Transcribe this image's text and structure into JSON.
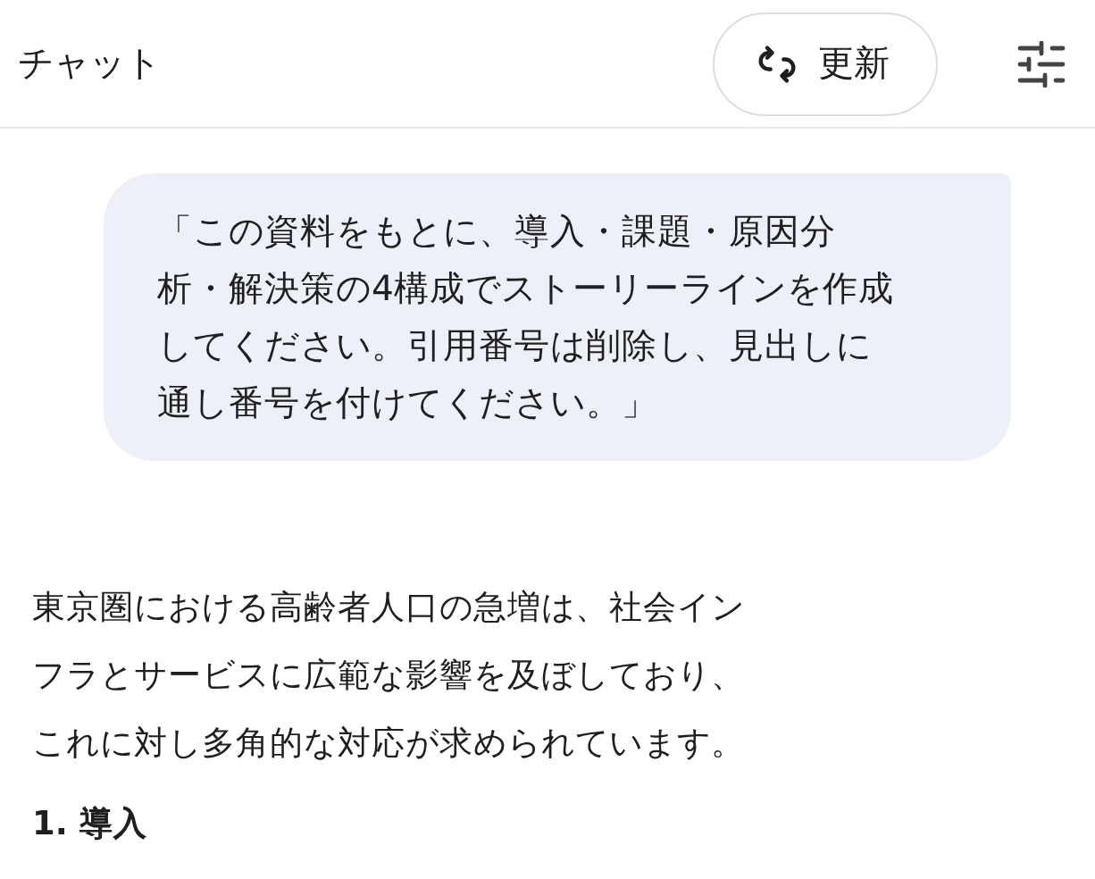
{
  "header": {
    "title": "チャット",
    "refresh_button": "更新"
  },
  "messages": [
    {
      "kind": "user",
      "lines": [
        "「この資料をもとに、導入・課題・原因分",
        "析・解決策の4構成でストーリーラインを作成",
        "してください。引用番号は削除し、見出しに",
        "通し番号を付けてください。」"
      ]
    },
    {
      "kind": "assistant",
      "lines": [
        "東京圏における高齢者人口の急増は、社会イン",
        "フラとサービスに広範な影響を及ぼしており、",
        "これに対し多角的な対応が求められています。"
      ]
    },
    {
      "kind": "heading",
      "text": "1. 導入"
    }
  ]
}
